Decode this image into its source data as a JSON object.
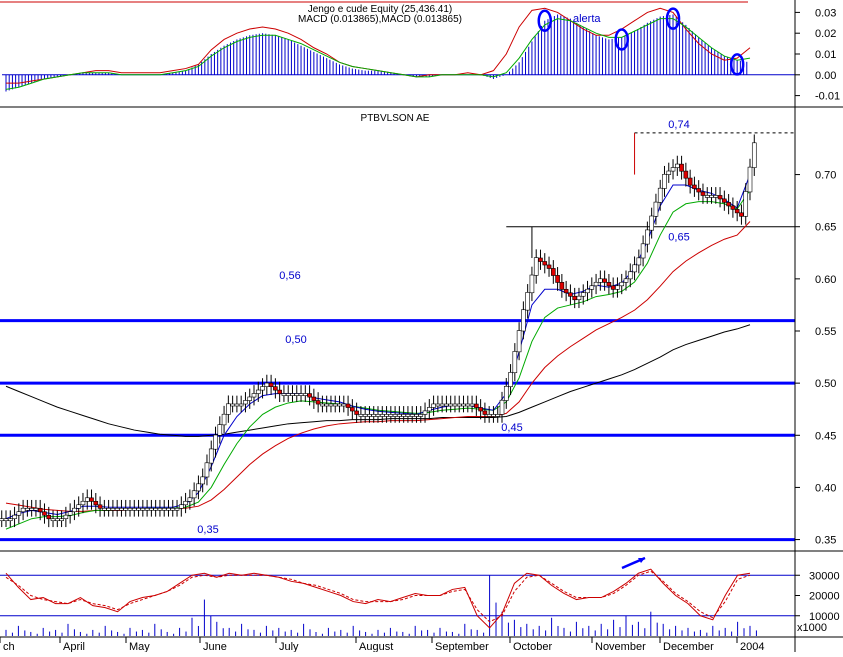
{
  "colors": {
    "candle_up": "#ffffff",
    "candle_down": "#e00000",
    "level": "#0000ff",
    "ma_fast": "#0000cc",
    "ma_mid": "#00aa00",
    "ma_slow": "#cc0000",
    "ma_long": "#000000",
    "macd_hist": "#0000cc",
    "stoch_k": "#cc0000",
    "volume": "#0000cc",
    "annotation": "#0000ff"
  },
  "chart_data": [
    {
      "panel": "macd",
      "type": "bar",
      "title_line1": "Jengo e cude Equity (25,436.41)",
      "title_line2": "MACD (0.013865),MACD (0.013865)",
      "annotation": "alerta",
      "ylim": [
        -0.015,
        0.035
      ],
      "y_ticks": [
        "0.03",
        "0.02",
        "0.01",
        "0.00",
        "-0.01"
      ],
      "y_tick_values": [
        0.03,
        0.02,
        0.01,
        0.0,
        -0.01
      ],
      "series": [
        {
          "values": [
            -0.008,
            -0.006,
            -0.004,
            -0.002,
            -0.001,
            0.0,
            0.001,
            0.001,
            0.001,
            0.0,
            0.0,
            0.0,
            0.0,
            0.001,
            0.002,
            0.005,
            0.01,
            0.014,
            0.017,
            0.019,
            0.02,
            0.019,
            0.017,
            0.014,
            0.011,
            0.008,
            0.005,
            0.003,
            0.002,
            0.002,
            0.001,
            0.0,
            -0.001,
            -0.001,
            0.0,
            0.0,
            0.0,
            0.0,
            -0.002,
            0.0,
            0.006,
            0.016,
            0.026,
            0.029,
            0.027,
            0.023,
            0.019,
            0.017,
            0.018,
            0.021,
            0.025,
            0.028,
            0.029,
            0.024,
            0.018,
            0.013,
            0.009,
            0.007,
            0.006
          ]
        },
        {
          "values": [
            -0.004,
            -0.004,
            -0.003,
            -0.002,
            -0.001,
            0.0,
            0.001,
            0.002,
            0.002,
            0.001,
            0.001,
            0.001,
            0.001,
            0.002,
            0.003,
            0.005,
            0.012,
            0.017,
            0.02,
            0.022,
            0.023,
            0.022,
            0.02,
            0.017,
            0.013,
            0.01,
            0.006,
            0.004,
            0.003,
            0.002,
            0.001,
            0.0,
            -0.001,
            0.0,
            0.0,
            0.0,
            0.001,
            0.0,
            0.002,
            0.01,
            0.023,
            0.031,
            0.032,
            0.03,
            0.026,
            0.022,
            0.019,
            0.019,
            0.022,
            0.026,
            0.03,
            0.032,
            0.03,
            0.022,
            0.015,
            0.01,
            0.007,
            0.008,
            0.013
          ]
        },
        {
          "values": [
            -0.007,
            -0.006,
            -0.004,
            -0.002,
            -0.001,
            0.0,
            0.001,
            0.001,
            0.001,
            0.0,
            0.0,
            0.0,
            0.0,
            0.001,
            0.002,
            0.004,
            0.009,
            0.013,
            0.016,
            0.018,
            0.019,
            0.019,
            0.017,
            0.015,
            0.012,
            0.009,
            0.006,
            0.004,
            0.003,
            0.002,
            0.001,
            0.0,
            -0.001,
            -0.001,
            0.0,
            0.0,
            0.0,
            0.0,
            -0.001,
            0.001,
            0.008,
            0.017,
            0.024,
            0.027,
            0.026,
            0.023,
            0.02,
            0.018,
            0.018,
            0.021,
            0.024,
            0.027,
            0.027,
            0.023,
            0.018,
            0.013,
            0.009,
            0.007,
            0.008
          ]
        }
      ]
    },
    {
      "panel": "price",
      "type": "line",
      "title": "PTBVLSON AE",
      "ylim": [
        0.34,
        0.76
      ],
      "y_ticks": [
        "0.70",
        "0.65",
        "0.60",
        "0.55",
        "0.50",
        "0.45",
        "0.40",
        "0.35"
      ],
      "y_tick_values": [
        0.7,
        0.65,
        0.6,
        0.55,
        0.5,
        0.45,
        0.4,
        0.35
      ],
      "x_months": [
        "ch",
        "April",
        "May",
        "June",
        "July",
        "August",
        "September",
        "October",
        "November",
        "December",
        "2004"
      ],
      "levels": [
        {
          "value": 0.56,
          "label": "0,56"
        },
        {
          "value": 0.5,
          "label": "0,50"
        },
        {
          "value": 0.45,
          "label": "0,45"
        },
        {
          "value": 0.35,
          "label": "0,35"
        }
      ],
      "annotations": [
        {
          "value": 0.74,
          "label": "0,74"
        },
        {
          "value": 0.65,
          "label": "0,65"
        }
      ],
      "close": [
        0.37,
        0.38,
        0.38,
        0.37,
        0.37,
        0.38,
        0.39,
        0.38,
        0.38,
        0.38,
        0.38,
        0.38,
        0.38,
        0.38,
        0.39,
        0.41,
        0.45,
        0.48,
        0.48,
        0.49,
        0.5,
        0.49,
        0.49,
        0.49,
        0.48,
        0.48,
        0.48,
        0.47,
        0.47,
        0.47,
        0.47,
        0.47,
        0.47,
        0.48,
        0.48,
        0.48,
        0.48,
        0.47,
        0.47,
        0.51,
        0.57,
        0.62,
        0.61,
        0.59,
        0.58,
        0.59,
        0.6,
        0.59,
        0.6,
        0.62,
        0.66,
        0.7,
        0.71,
        0.69,
        0.68,
        0.68,
        0.67,
        0.66,
        0.73
      ],
      "series": [
        {
          "values": [
            0.37,
            0.375,
            0.378,
            0.376,
            0.374,
            0.377,
            0.382,
            0.382,
            0.381,
            0.381,
            0.381,
            0.381,
            0.381,
            0.381,
            0.384,
            0.395,
            0.42,
            0.45,
            0.468,
            0.48,
            0.488,
            0.49,
            0.49,
            0.49,
            0.486,
            0.484,
            0.482,
            0.478,
            0.475,
            0.473,
            0.472,
            0.471,
            0.47,
            0.474,
            0.477,
            0.479,
            0.479,
            0.476,
            0.474,
            0.49,
            0.53,
            0.575,
            0.59,
            0.59,
            0.585,
            0.588,
            0.594,
            0.592,
            0.596,
            0.61,
            0.636,
            0.67,
            0.69,
            0.69,
            0.685,
            0.682,
            0.676,
            0.668,
            0.7
          ]
        },
        {
          "values": [
            0.36,
            0.365,
            0.37,
            0.372,
            0.372,
            0.373,
            0.376,
            0.378,
            0.378,
            0.379,
            0.379,
            0.38,
            0.38,
            0.38,
            0.381,
            0.386,
            0.4,
            0.422,
            0.442,
            0.458,
            0.47,
            0.477,
            0.481,
            0.483,
            0.482,
            0.481,
            0.48,
            0.478,
            0.476,
            0.474,
            0.473,
            0.472,
            0.471,
            0.472,
            0.474,
            0.475,
            0.476,
            0.475,
            0.474,
            0.482,
            0.505,
            0.54,
            0.563,
            0.572,
            0.575,
            0.578,
            0.583,
            0.585,
            0.588,
            0.597,
            0.615,
            0.642,
            0.664,
            0.672,
            0.674,
            0.674,
            0.672,
            0.667,
            0.685
          ]
        },
        {
          "values": [
            0.385,
            0.383,
            0.381,
            0.379,
            0.378,
            0.377,
            0.377,
            0.378,
            0.378,
            0.378,
            0.379,
            0.379,
            0.379,
            0.38,
            0.38,
            0.382,
            0.388,
            0.398,
            0.41,
            0.422,
            0.432,
            0.44,
            0.447,
            0.452,
            0.456,
            0.459,
            0.461,
            0.462,
            0.463,
            0.463,
            0.464,
            0.464,
            0.464,
            0.465,
            0.466,
            0.467,
            0.468,
            0.468,
            0.468,
            0.471,
            0.482,
            0.5,
            0.515,
            0.526,
            0.535,
            0.543,
            0.551,
            0.557,
            0.563,
            0.57,
            0.58,
            0.593,
            0.607,
            0.617,
            0.625,
            0.632,
            0.638,
            0.642,
            0.655
          ]
        },
        {
          "values": [
            0.497,
            0.492,
            0.487,
            0.482,
            0.477,
            0.473,
            0.469,
            0.465,
            0.461,
            0.458,
            0.455,
            0.453,
            0.451,
            0.45,
            0.449,
            0.449,
            0.45,
            0.451,
            0.453,
            0.455,
            0.457,
            0.459,
            0.461,
            0.462,
            0.463,
            0.464,
            0.464,
            0.465,
            0.465,
            0.465,
            0.466,
            0.466,
            0.466,
            0.466,
            0.467,
            0.467,
            0.467,
            0.467,
            0.467,
            0.468,
            0.472,
            0.477,
            0.482,
            0.487,
            0.492,
            0.496,
            0.5,
            0.504,
            0.508,
            0.513,
            0.519,
            0.525,
            0.532,
            0.537,
            0.541,
            0.545,
            0.549,
            0.552,
            0.556
          ]
        }
      ]
    },
    {
      "panel": "stochastic_volume",
      "type": "line",
      "ylim": [
        0,
        40000
      ],
      "y_ticks": [
        "30000",
        "20000",
        "10000"
      ],
      "y_tick_values": [
        30000,
        20000,
        10000
      ],
      "x_unit": "x1000",
      "series": [
        {
          "values": [
            31000,
            24000,
            18000,
            19000,
            16000,
            16000,
            19000,
            15000,
            14000,
            12000,
            17000,
            19000,
            20000,
            22000,
            26000,
            30000,
            31000,
            29000,
            31000,
            30000,
            31000,
            30000,
            29000,
            27000,
            26000,
            24000,
            22000,
            20000,
            17000,
            16000,
            18000,
            17000,
            19000,
            21000,
            20000,
            20000,
            23000,
            24000,
            10000,
            4000,
            11000,
            26000,
            31000,
            30000,
            25000,
            21000,
            18000,
            19000,
            19000,
            22000,
            26000,
            31000,
            33000,
            26000,
            20000,
            16000,
            10000,
            8000,
            20000,
            30000,
            31000
          ]
        },
        {
          "values": [
            29000,
            25000,
            20000,
            18000,
            17000,
            16000,
            18000,
            16000,
            15000,
            13000,
            16000,
            18000,
            20000,
            22000,
            25000,
            29000,
            30000,
            29000,
            30000,
            30000,
            30000,
            30000,
            29000,
            28000,
            26000,
            25000,
            23000,
            21000,
            18000,
            17000,
            17000,
            17000,
            18000,
            20000,
            20000,
            20000,
            22000,
            23000,
            13000,
            7000,
            10000,
            22000,
            29000,
            30000,
            26000,
            22000,
            19000,
            19000,
            19000,
            21000,
            25000,
            30000,
            32000,
            27000,
            21000,
            17000,
            12000,
            9000,
            17000,
            28000,
            30000
          ]
        }
      ],
      "volume": [
        3000,
        5000,
        2000,
        4000,
        3000,
        6000,
        2000,
        3000,
        5000,
        2000,
        4000,
        3000,
        6000,
        2000,
        4000,
        9000,
        18000,
        7000,
        4000,
        6000,
        3000,
        5000,
        4000,
        3000,
        6000,
        2000,
        4000,
        3000,
        5000,
        2000,
        3000,
        4000,
        2000,
        5000,
        3000,
        4000,
        2000,
        6000,
        3000,
        30000,
        12000,
        8000,
        6000,
        5000,
        9000,
        4000,
        7000,
        5000,
        6000,
        8000,
        10000,
        7000,
        12000,
        6000,
        5000,
        4000,
        3000,
        5000,
        4000,
        7000,
        5000
      ]
    }
  ]
}
